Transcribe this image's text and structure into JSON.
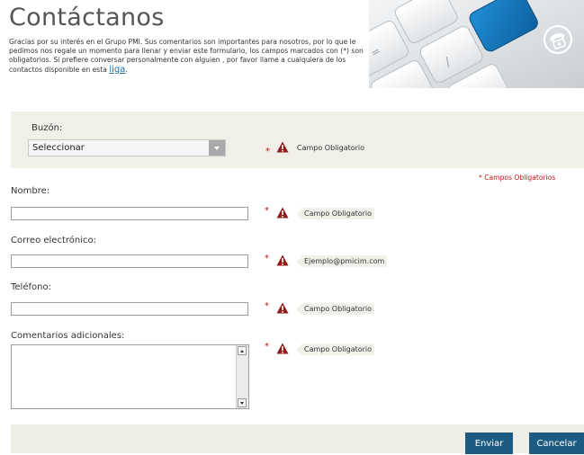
{
  "page": {
    "title": "Contáctanos",
    "intro_text": "Gracias por su interés en el Grupo PMI. Sus comentarios son importantes para nosotros, por lo que le pedimos nos regale un momento para llenar y enviar este formulario, los campos marcados con (*) son obligatorios. Si prefiere conversar personalmente con alguien , por favor llame a cualquiera de los contactos disponible en esta",
    "intro_link": "liga",
    "intro_end": "."
  },
  "buzon": {
    "label": "Buzón:",
    "selected": "Seleccionar",
    "required_mark": "*",
    "hint": "Campo Obligatorio"
  },
  "required_note": "* Campos Obligatorios",
  "fields": {
    "nombre": {
      "label": "Nombre:",
      "required_mark": "*",
      "hint": "Campo Obligatorio"
    },
    "correo": {
      "label": "Correo electrónico:",
      "required_mark": "*",
      "hint": "Ejemplo@pmicim.com"
    },
    "telefono": {
      "label": "Teléfono:",
      "required_mark": "*",
      "hint": "Campo Obligatorio"
    },
    "comentarios": {
      "label": "Comentarios adicionales:",
      "required_mark": "*",
      "hint": "Campo Obligatorio"
    }
  },
  "buttons": {
    "send": "Enviar",
    "cancel": "Cancelar"
  },
  "icons": {
    "warning": "warning-icon",
    "phone_key": "phone-icon"
  },
  "colors": {
    "accent": "#1e5b80",
    "required": "#b11c1c",
    "panel": "#f0efe8"
  }
}
